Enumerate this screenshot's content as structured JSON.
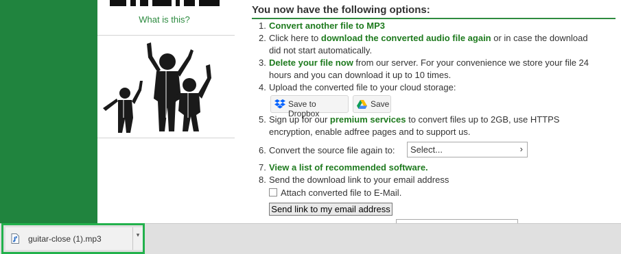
{
  "left_panel": {
    "what_link": "What is this?"
  },
  "main": {
    "title": "You now have the following options:",
    "items": [
      {
        "num": "1.",
        "bold": "Convert another file to MP3"
      },
      {
        "num": "2.",
        "pre": "Click here to ",
        "bold": "download the converted audio file again",
        "post": " or in case the download",
        "line2": "did not start automatically."
      },
      {
        "num": "3.",
        "bold": "Delete your file now",
        "post": " from our server. For your convenience we store your file 24",
        "line2": "hours and you can download it up to 10 times."
      },
      {
        "num": "4.",
        "text": "Upload the converted file to your cloud storage:"
      },
      {
        "num": "5.",
        "pre": "Sign up for our ",
        "bold": "premium services",
        "post": " to convert files up to 2GB, use HTTPS",
        "line2": "encryption, enable adfree pages and to support us."
      },
      {
        "num": "6.",
        "text": "Convert the source file again to:"
      },
      {
        "num": "7.",
        "bold": "View a list of recommended software."
      },
      {
        "num": "8.",
        "text": "Send the download link to your email address"
      }
    ],
    "dropbox_button": "Save to Dropbox",
    "save_button": "Save",
    "select_value": "Select...",
    "attach_label": "Attach converted file to E-Mail.",
    "send_button": "Send link to my email address"
  },
  "downloads": {
    "filename": "guitar-close (1).mp3",
    "file_icon": "audio-file-icon"
  },
  "colors": {
    "brand_green": "#20843e",
    "link_green": "#1e7a1e",
    "download_highlight": "#22b14c"
  }
}
